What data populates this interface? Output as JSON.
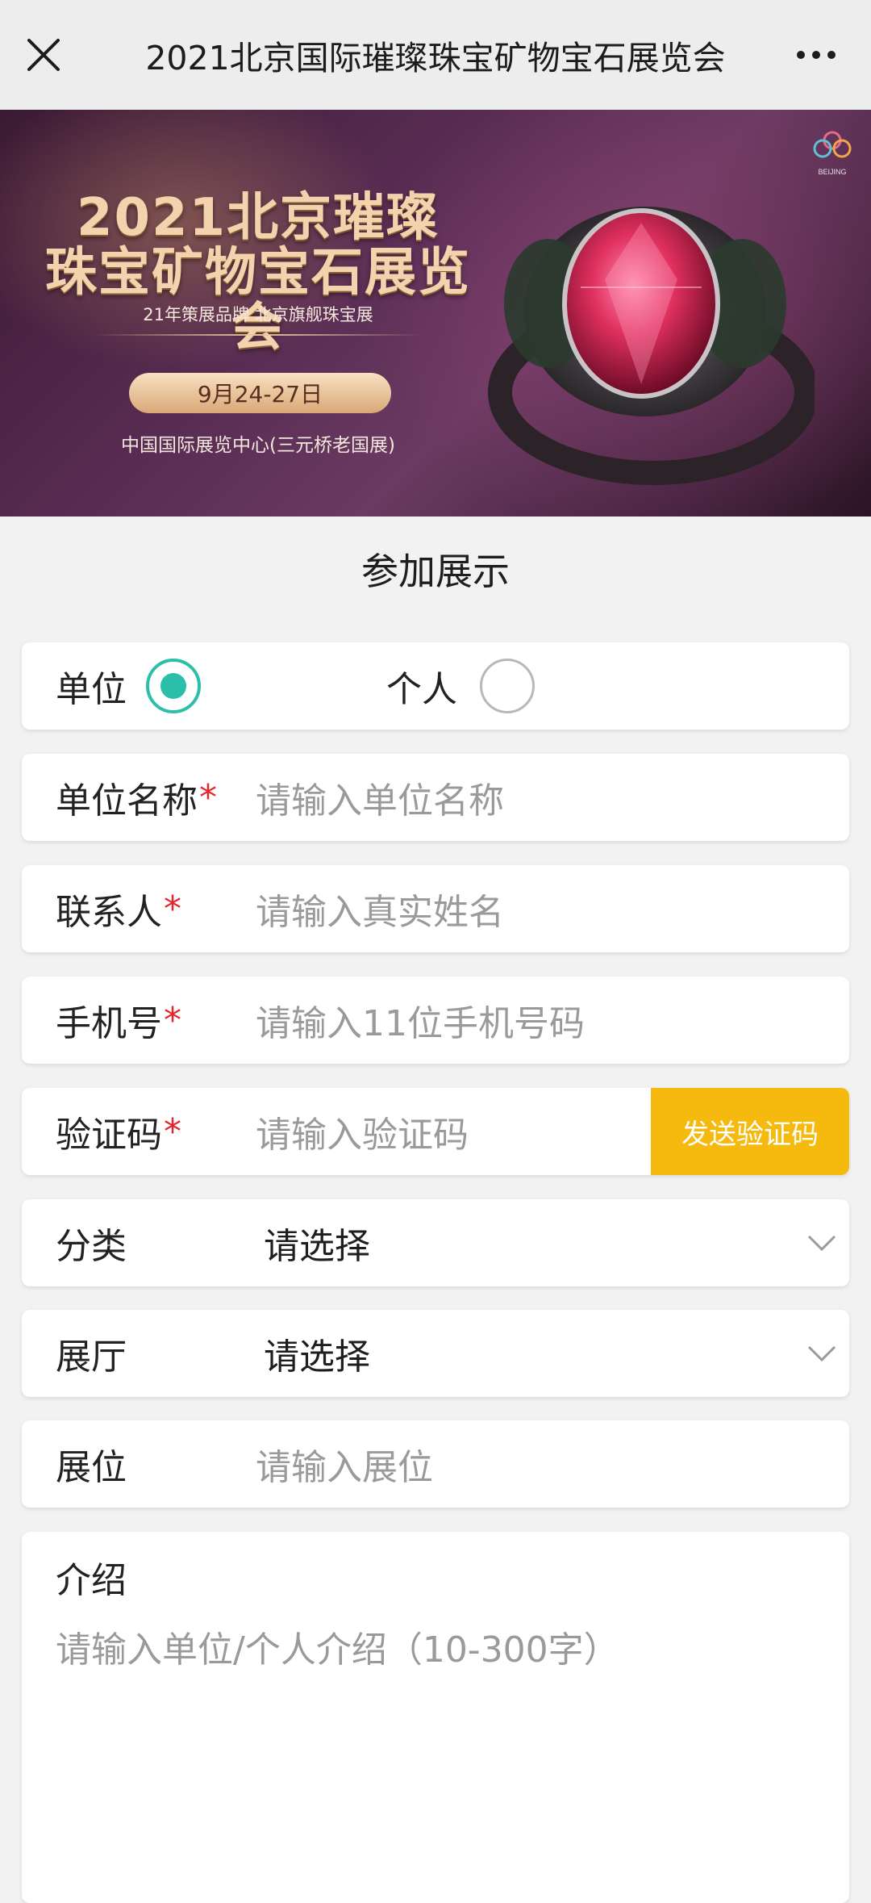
{
  "header": {
    "title": "2021北京国际璀璨珠宝矿物宝石展览会",
    "close_icon": "close-icon",
    "more_icon": "more-icon"
  },
  "banner": {
    "title_line1": "2021北京璀璨",
    "title_line2": "珠宝矿物宝石展览会",
    "subtitle": "21年策展品牌   北京旗舰珠宝展",
    "date": "9月24-27日",
    "venue": "中国国际展览中心(三元桥老国展)",
    "logo_text": "BEIJING"
  },
  "form": {
    "section_title": "参加展示",
    "type": {
      "option_company": "单位",
      "option_personal": "个人",
      "selected": "单位"
    },
    "company_name": {
      "label": "单位名称",
      "required_mark": "*",
      "placeholder": "请输入单位名称"
    },
    "contact": {
      "label": "联系人",
      "required_mark": "*",
      "placeholder": "请输入真实姓名"
    },
    "phone": {
      "label": "手机号",
      "required_mark": "*",
      "placeholder": "请输入11位手机号码"
    },
    "code": {
      "label": "验证码",
      "required_mark": "*",
      "placeholder": "请输入验证码",
      "send_button": "发送验证码"
    },
    "category": {
      "label": "分类",
      "value": "请选择"
    },
    "hall": {
      "label": "展厅",
      "value": "请选择"
    },
    "booth": {
      "label": "展位",
      "placeholder": "请输入展位"
    },
    "intro": {
      "label": "介绍",
      "placeholder": "请输入单位/个人介绍（10-300字）"
    }
  },
  "colors": {
    "accent_radio": "#2bbfaa",
    "send_button_bg": "#f6b90e",
    "required": "#e3262b"
  }
}
